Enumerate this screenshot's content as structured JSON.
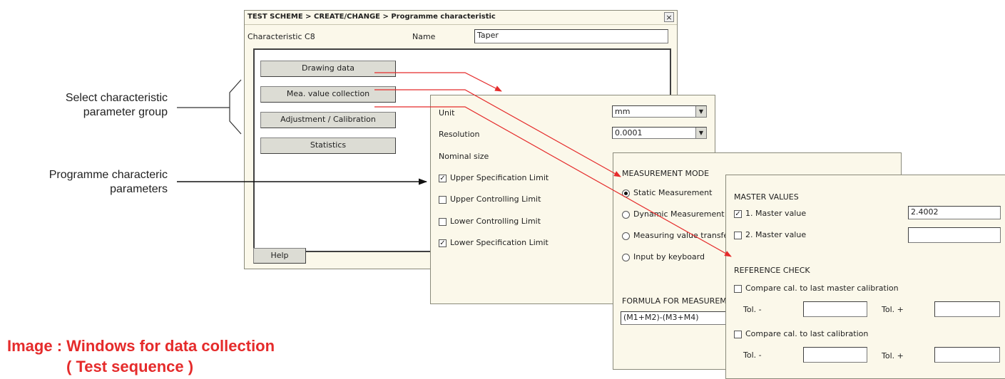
{
  "main_window": {
    "title": "TEST SCHEME > CREATE/CHANGE > Programme characteristic",
    "characteristic_label": "Characteristic C8",
    "name_label": "Name",
    "name_value": "Taper",
    "buttons": [
      "Drawing data",
      "Mea. value collection",
      "Adjustment / Calibration",
      "Statistics"
    ],
    "help_label": "Help"
  },
  "panel1": {
    "unit_label": "Unit",
    "unit_value": "mm",
    "resolution_label": "Resolution",
    "resolution_value": "0.0001",
    "nominal_label": "Nominal size",
    "limits": [
      {
        "label": "Upper Specification Limit",
        "checked": true
      },
      {
        "label": "Upper Controlling Limit",
        "checked": false
      },
      {
        "label": "Lower Controlling Limit",
        "checked": false
      },
      {
        "label": "Lower Specification Limit",
        "checked": true
      }
    ]
  },
  "panel2": {
    "heading": "MEASUREMENT MODE",
    "modes": [
      {
        "label": "Static Measurement",
        "selected": true
      },
      {
        "label": "Dynamic Measurement",
        "selected": false
      },
      {
        "label": "Measuring value transfer",
        "selected": false
      },
      {
        "label": "Input by keyboard",
        "selected": false
      }
    ],
    "formula_heading": "FORMULA FOR MEASUREMENT",
    "formula_value": "(M1+M2)-(M3+M4)"
  },
  "panel3": {
    "master_heading": "MASTER VALUES",
    "master1_label": "1. Master value",
    "master1_value": "2.4002",
    "master2_label": "2. Master value",
    "master2_value": "",
    "ref_heading": "REFERENCE CHECK",
    "compare1_label": "Compare cal. to last master calibration",
    "compare2_label": "Compare cal. to last calibration",
    "tol_minus": "Tol. -",
    "tol_plus": "Tol. +"
  },
  "annotations": {
    "select_group": "Select characteristic parameter group",
    "programme_params": "Programme characteric parameters"
  },
  "caption": {
    "line1": "Image :  Windows for data collection",
    "line2": "( Test sequence )"
  },
  "colors": {
    "accent": "#e52b2b",
    "window_bg": "#fbf8ea"
  }
}
